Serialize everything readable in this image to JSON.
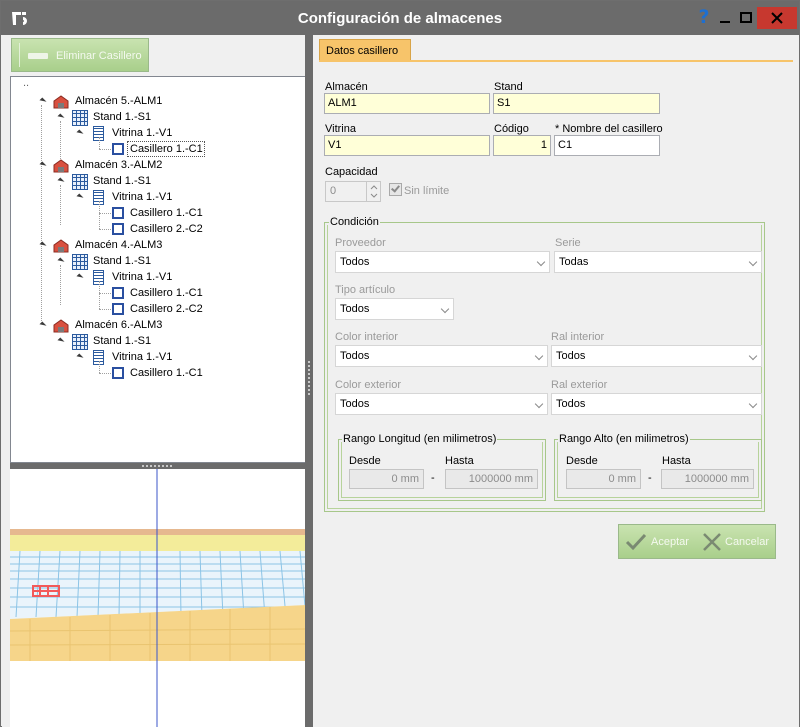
{
  "window": {
    "title": "Configuración de almacenes",
    "help_glyph": "?"
  },
  "toolbar": {
    "delete_label": "Eliminar Casillero"
  },
  "tree": {
    "root_label": "..",
    "nodes": [
      {
        "label": "Almacén 5.-ALM1",
        "type": "almacen"
      },
      {
        "label": "Stand 1.-S1",
        "type": "stand"
      },
      {
        "label": "Vitrina 1.-V1",
        "type": "vitrina"
      },
      {
        "label": "Casillero 1.-C1",
        "type": "casillero",
        "selected": true
      },
      {
        "label": "Almacén 3.-ALM2",
        "type": "almacen"
      },
      {
        "label": "Stand 1.-S1",
        "type": "stand"
      },
      {
        "label": "Vitrina 1.-V1",
        "type": "vitrina"
      },
      {
        "label": "Casillero 1.-C1",
        "type": "casillero"
      },
      {
        "label": "Casillero 2.-C2",
        "type": "casillero"
      },
      {
        "label": "Almacén 4.-ALM3",
        "type": "almacen"
      },
      {
        "label": "Stand 1.-S1",
        "type": "stand"
      },
      {
        "label": "Vitrina 1.-V1",
        "type": "vitrina"
      },
      {
        "label": "Casillero 1.-C1",
        "type": "casillero"
      },
      {
        "label": "Casillero 2.-C2",
        "type": "casillero"
      },
      {
        "label": "Almacén 6.-ALM3",
        "type": "almacen"
      },
      {
        "label": "Stand 1.-S1",
        "type": "stand"
      },
      {
        "label": "Vitrina 1.-V1",
        "type": "vitrina"
      },
      {
        "label": "Casillero 1.-C1",
        "type": "casillero"
      }
    ]
  },
  "tab": {
    "label": "Datos casillero"
  },
  "form": {
    "almacen_label": "Almacén",
    "almacen_value": "ALM1",
    "stand_label": "Stand",
    "stand_value": "S1",
    "vitrina_label": "Vitrina",
    "vitrina_value": "V1",
    "codigo_label": "Código",
    "codigo_value": "1",
    "nombre_label": "* Nombre del casillero",
    "nombre_value": "C1",
    "capacidad_label": "Capacidad",
    "capacidad_value": "0",
    "sin_limite_label": "Sin límite",
    "sin_limite_checked": true
  },
  "condicion": {
    "legend": "Condición",
    "proveedor_label": "Proveedor",
    "proveedor_value": "Todos",
    "serie_label": "Serie",
    "serie_value": "Todas",
    "tipo_label": "Tipo artículo",
    "tipo_value": "Todos",
    "color_int_label": "Color interior",
    "color_int_value": "Todos",
    "ral_int_label": "Ral interior",
    "ral_int_value": "Todos",
    "color_ext_label": "Color exterior",
    "color_ext_value": "Todos",
    "ral_ext_label": "Ral exterior",
    "ral_ext_value": "Todos",
    "longitud": {
      "legend": "Rango Longitud (en milimetros)",
      "desde_label": "Desde",
      "hasta_label": "Hasta",
      "desde_value": "0 mm",
      "hasta_value": "1000000 mm",
      "sep": "-"
    },
    "alto": {
      "legend": "Rango Alto (en milimetros)",
      "desde_label": "Desde",
      "hasta_label": "Hasta",
      "desde_value": "0 mm",
      "hasta_value": "1000000 mm",
      "sep": "-"
    }
  },
  "buttons": {
    "accept_label": "Aceptar",
    "cancel_label": "Cancelar"
  },
  "colors": {
    "titlebar": "#6b6b6b",
    "accent_tab": "#f7c46a",
    "button_green": "#a9cf8b",
    "close_red": "#c7382f"
  }
}
